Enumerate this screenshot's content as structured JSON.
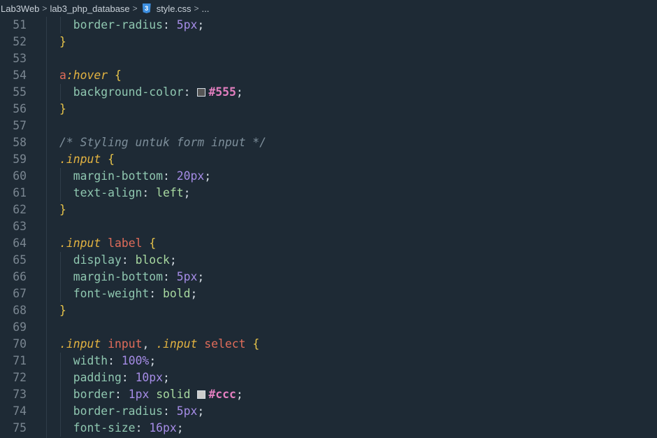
{
  "breadcrumb": {
    "items": [
      "Lab3Web",
      "lab3_php_database",
      "style.css",
      "..."
    ],
    "separator": ">",
    "file_icon_label": "3"
  },
  "colors": {
    "background": "#1e2a35",
    "swatch_555": "#555555",
    "swatch_ccc": "#cccccc"
  },
  "lines": [
    {
      "n": "51",
      "t": [
        [
          "prop",
          "  border-radius"
        ],
        [
          "punc",
          ": "
        ],
        [
          "num",
          "5px"
        ],
        [
          "punc",
          ";"
        ]
      ]
    },
    {
      "n": "52",
      "t": [
        [
          "brace",
          "}"
        ]
      ]
    },
    {
      "n": "53",
      "t": []
    },
    {
      "n": "54",
      "t": [
        [
          "sel",
          "a"
        ],
        [
          "pseudo",
          ":hover"
        ],
        [
          "punc",
          " "
        ],
        [
          "brace",
          "{"
        ]
      ]
    },
    {
      "n": "55",
      "t": [
        [
          "prop",
          "  background-color"
        ],
        [
          "punc",
          ": "
        ],
        [
          "swatch",
          "#555555"
        ],
        [
          "hex",
          "#555"
        ],
        [
          "punc",
          ";"
        ]
      ]
    },
    {
      "n": "56",
      "t": [
        [
          "brace",
          "}"
        ]
      ]
    },
    {
      "n": "57",
      "t": []
    },
    {
      "n": "58",
      "t": [
        [
          "com",
          "/* Styling untuk form input */"
        ]
      ]
    },
    {
      "n": "59",
      "t": [
        [
          "cls",
          ".input"
        ],
        [
          "punc",
          " "
        ],
        [
          "brace",
          "{"
        ]
      ]
    },
    {
      "n": "60",
      "t": [
        [
          "prop",
          "  margin-bottom"
        ],
        [
          "punc",
          ": "
        ],
        [
          "num",
          "20px"
        ],
        [
          "punc",
          ";"
        ]
      ]
    },
    {
      "n": "61",
      "t": [
        [
          "prop",
          "  text-align"
        ],
        [
          "punc",
          ": "
        ],
        [
          "val",
          "left"
        ],
        [
          "punc",
          ";"
        ]
      ]
    },
    {
      "n": "62",
      "t": [
        [
          "brace",
          "}"
        ]
      ]
    },
    {
      "n": "63",
      "t": []
    },
    {
      "n": "64",
      "t": [
        [
          "cls",
          ".input"
        ],
        [
          "punc",
          " "
        ],
        [
          "sel",
          "label"
        ],
        [
          "punc",
          " "
        ],
        [
          "brace",
          "{"
        ]
      ]
    },
    {
      "n": "65",
      "t": [
        [
          "prop",
          "  display"
        ],
        [
          "punc",
          ": "
        ],
        [
          "val",
          "block"
        ],
        [
          "punc",
          ";"
        ]
      ]
    },
    {
      "n": "66",
      "t": [
        [
          "prop",
          "  margin-bottom"
        ],
        [
          "punc",
          ": "
        ],
        [
          "num",
          "5px"
        ],
        [
          "punc",
          ";"
        ]
      ]
    },
    {
      "n": "67",
      "t": [
        [
          "prop",
          "  font-weight"
        ],
        [
          "punc",
          ": "
        ],
        [
          "val",
          "bold"
        ],
        [
          "punc",
          ";"
        ]
      ]
    },
    {
      "n": "68",
      "t": [
        [
          "brace",
          "}"
        ]
      ]
    },
    {
      "n": "69",
      "t": []
    },
    {
      "n": "70",
      "t": [
        [
          "cls",
          ".input"
        ],
        [
          "punc",
          " "
        ],
        [
          "sel",
          "input"
        ],
        [
          "punc",
          ", "
        ],
        [
          "cls",
          ".input"
        ],
        [
          "punc",
          " "
        ],
        [
          "sel",
          "select"
        ],
        [
          "punc",
          " "
        ],
        [
          "brace",
          "{"
        ]
      ]
    },
    {
      "n": "71",
      "t": [
        [
          "prop",
          "  width"
        ],
        [
          "punc",
          ": "
        ],
        [
          "num",
          "100%"
        ],
        [
          "punc",
          ";"
        ]
      ]
    },
    {
      "n": "72",
      "t": [
        [
          "prop",
          "  padding"
        ],
        [
          "punc",
          ": "
        ],
        [
          "num",
          "10px"
        ],
        [
          "punc",
          ";"
        ]
      ]
    },
    {
      "n": "73",
      "t": [
        [
          "prop",
          "  border"
        ],
        [
          "punc",
          ": "
        ],
        [
          "num",
          "1px"
        ],
        [
          "punc",
          " "
        ],
        [
          "val",
          "solid"
        ],
        [
          "punc",
          " "
        ],
        [
          "swatch",
          "#cccccc"
        ],
        [
          "hex",
          "#ccc"
        ],
        [
          "punc",
          ";"
        ]
      ]
    },
    {
      "n": "74",
      "t": [
        [
          "prop",
          "  border-radius"
        ],
        [
          "punc",
          ": "
        ],
        [
          "num",
          "5px"
        ],
        [
          "punc",
          ";"
        ]
      ]
    },
    {
      "n": "75",
      "t": [
        [
          "prop",
          "  font-size"
        ],
        [
          "punc",
          ": "
        ],
        [
          "num",
          "16px"
        ],
        [
          "punc",
          ";"
        ]
      ]
    }
  ]
}
